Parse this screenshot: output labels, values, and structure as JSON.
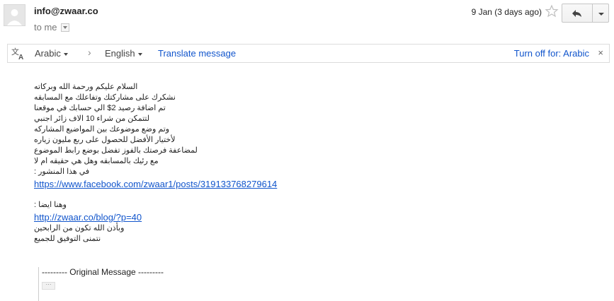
{
  "header": {
    "sender": "info@zwaar.co",
    "recipient_label": "to me",
    "date": "9 Jan (3 days ago)",
    "icons": {
      "avatar": "default-avatar-icon",
      "star": "star-icon",
      "reply": "reply-icon",
      "more": "chevron-down-icon"
    }
  },
  "translate": {
    "source_lang": "Arabic",
    "target_lang": "English",
    "translate_link": "Translate message",
    "turn_off": "Turn off for: Arabic",
    "close": "×",
    "icon": "translate-icon",
    "separator": "›"
  },
  "body": {
    "arabic_lines_1": [
      "السلام عليكم ورحمة الله وبركاته",
      "نشكرك على مشاركتك وتفاعلك مع المسابقه",
      "تم اضافة رصيد 2$ الي حسابك في موقعنا",
      "لتتمكن من شراء 10 الاف زائر اجنبي",
      "وتم وضع موضوعك بين المواضيع المشاركه",
      "لأختيار الأفضل للحصول على ربع مليون زياره",
      "لمضاعفة فرصتك بالفوز تفضل بوضع رابط الموضوع",
      "مع رئيك بالمسابقه وهل هي حقيقه ام لا",
      "في هذا المنشور :"
    ],
    "link_1": "https://www.facebook.com/zwaar1/posts/319133768279614",
    "arabic_lines_2": [
      "وهنا ايضا :"
    ],
    "link_2": "http://zwaar.co/blog/?p=40",
    "arabic_lines_3": [
      "وبأذن الله تكون من الرابحين",
      "نتمنى التوفيق للجميع"
    ]
  },
  "quoted": {
    "title": "--------- Original Message ---------",
    "show_trimmed": "···"
  },
  "colors": {
    "link": "#1155cc",
    "border": "#dcdcdc"
  }
}
